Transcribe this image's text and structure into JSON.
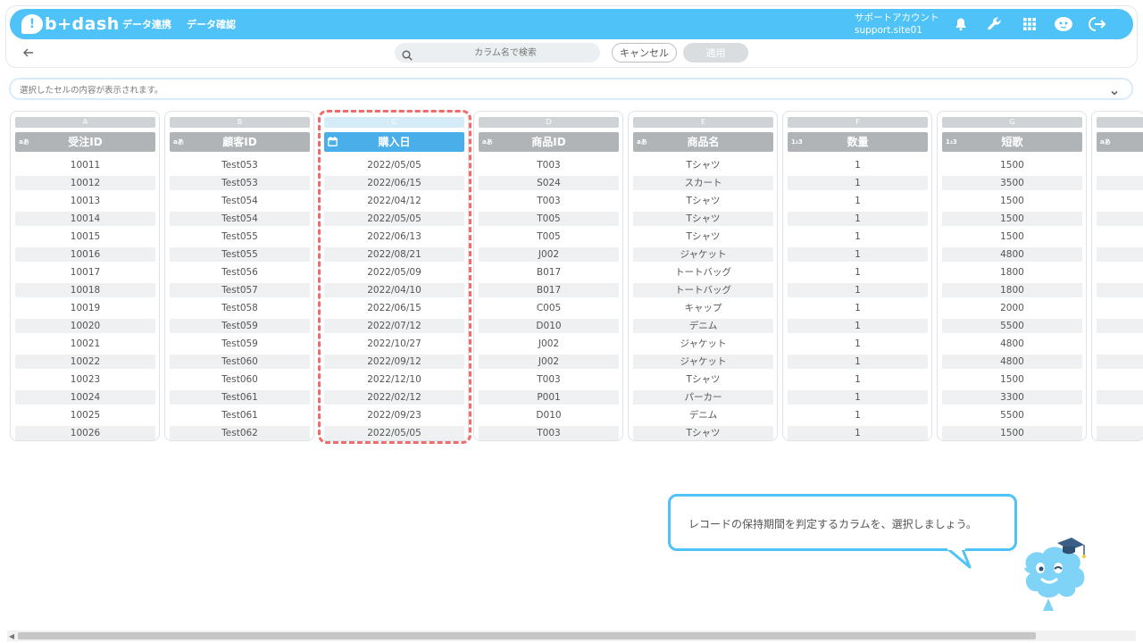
{
  "app": {
    "logo_text": "b+dash",
    "logo_mark": "!"
  },
  "nav": [
    {
      "label": "データ連携"
    },
    {
      "label": "データ確認"
    }
  ],
  "account": {
    "name": "サポートアカウント",
    "id": "support.site01"
  },
  "toolbar": {
    "search_placeholder": "カラム名で検索",
    "cancel_label": "キャンセル",
    "apply_label": "適用"
  },
  "cell_preview": {
    "text": "選択したセルの内容が表示されます。"
  },
  "columns": [
    {
      "letter": "A",
      "name": "受注ID",
      "type": "aあ",
      "values": [
        "10011",
        "10012",
        "10013",
        "10014",
        "10015",
        "10016",
        "10017",
        "10018",
        "10019",
        "10020",
        "10021",
        "10022",
        "10023",
        "10024",
        "10025",
        "10026"
      ]
    },
    {
      "letter": "B",
      "name": "顧客ID",
      "type": "aあ",
      "values": [
        "Test053",
        "Test053",
        "Test054",
        "Test054",
        "Test055",
        "Test055",
        "Test056",
        "Test057",
        "Test058",
        "Test059",
        "Test059",
        "Test060",
        "Test060",
        "Test061",
        "Test061",
        "Test062"
      ]
    },
    {
      "letter": "C",
      "name": "購入日",
      "type": "calendar",
      "selected": true,
      "values": [
        "2022/05/05",
        "2022/06/15",
        "2022/04/12",
        "2022/05/05",
        "2022/06/13",
        "2022/08/21",
        "2022/05/09",
        "2022/04/10",
        "2022/06/15",
        "2022/07/12",
        "2022/10/27",
        "2022/09/12",
        "2022/12/10",
        "2022/02/12",
        "2022/09/23",
        "2022/05/05"
      ]
    },
    {
      "letter": "D",
      "name": "商品ID",
      "type": "aあ",
      "values": [
        "T003",
        "S024",
        "T003",
        "T005",
        "T005",
        "J002",
        "B017",
        "B017",
        "C005",
        "D010",
        "J002",
        "J002",
        "T003",
        "P001",
        "D010",
        "T003"
      ]
    },
    {
      "letter": "E",
      "name": "商品名",
      "type": "aあ",
      "values": [
        "Tシャツ",
        "スカート",
        "Tシャツ",
        "Tシャツ",
        "Tシャツ",
        "ジャケット",
        "トートバッグ",
        "トートバッグ",
        "キャップ",
        "デニム",
        "ジャケット",
        "ジャケット",
        "Tシャツ",
        "パーカー",
        "デニム",
        "Tシャツ"
      ]
    },
    {
      "letter": "F",
      "name": "数量",
      "type": "1₂3",
      "values": [
        "1",
        "1",
        "1",
        "1",
        "1",
        "1",
        "1",
        "1",
        "1",
        "1",
        "1",
        "1",
        "1",
        "1",
        "1",
        "1"
      ]
    },
    {
      "letter": "G",
      "name": "短歌",
      "type": "1₂3",
      "values": [
        "1500",
        "3500",
        "1500",
        "1500",
        "1500",
        "4800",
        "1800",
        "1800",
        "2000",
        "5500",
        "4800",
        "4800",
        "1500",
        "3300",
        "5500",
        "1500"
      ]
    },
    {
      "letter": "",
      "name": "",
      "type": "aあ",
      "values": [
        "",
        "",
        "",
        "",
        "",
        "",
        "",
        "",
        "",
        "",
        "",
        "",
        "",
        "",
        "",
        ""
      ]
    }
  ],
  "guide": {
    "message": "レコードの保持期間を判定するカラムを、選択しましょう。"
  },
  "colors": {
    "brand": "#4fc3f7",
    "selected_header": "#4aaee8",
    "highlight_outline": "#ee6c6c"
  }
}
